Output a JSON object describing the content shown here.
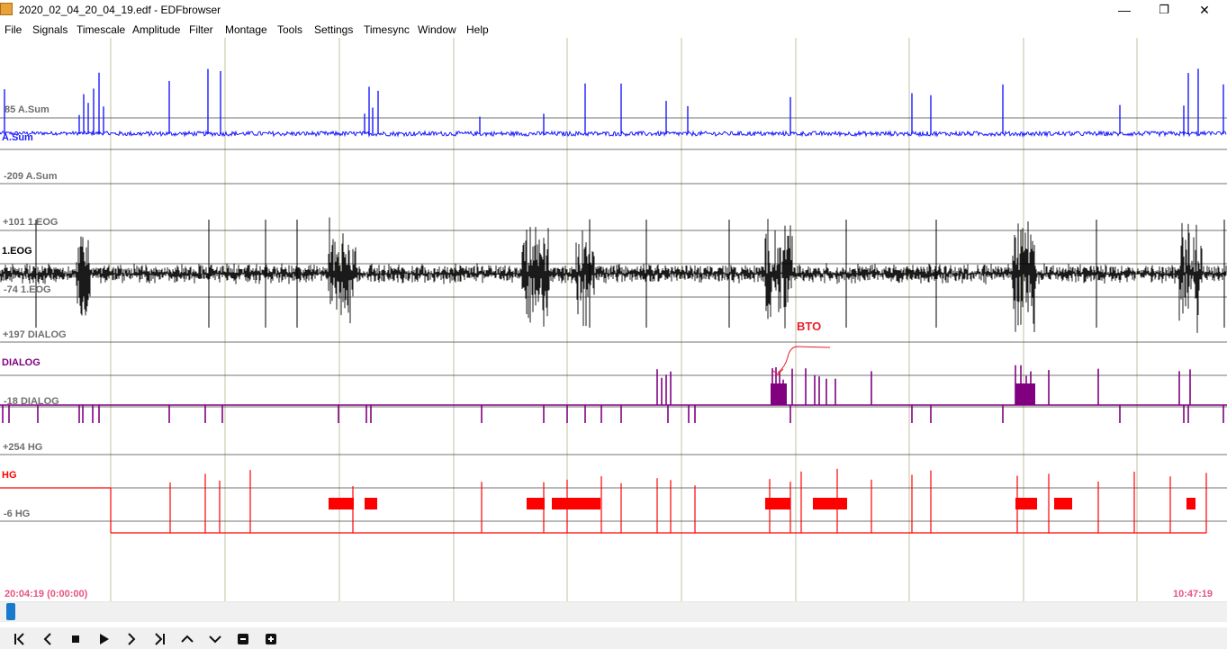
{
  "window": {
    "title": "2020_02_04_20_04_19.edf - EDFbrowser",
    "controls": {
      "minimize": "—",
      "restore": "❐",
      "close": "✕"
    }
  },
  "menu": [
    "File",
    "Signals",
    "Timescale",
    "Amplitude",
    "Filter",
    "Montage",
    "Tools",
    "Settings",
    "Timesync",
    "Window",
    "Help"
  ],
  "signals": [
    {
      "name": "A.Sum",
      "top_scale": "85 A.Sum",
      "bottom_scale": "-209 A.Sum",
      "color": "#1a1aff"
    },
    {
      "name": "1.EOG",
      "top_scale": "+101 1.EOG",
      "bottom_scale": "-74 1.EOG",
      "color": "#000000"
    },
    {
      "name": "DIALOG",
      "top_scale": "+197 DIALOG",
      "bottom_scale": "-18 DIALOG",
      "color": "#800080"
    },
    {
      "name": "HG",
      "top_scale": "+254 HG",
      "bottom_scale": "-6 HG",
      "color": "#ff0000"
    }
  ],
  "annotation": {
    "label": "BTO",
    "color": "#e8202a"
  },
  "timeline": {
    "start": "20:04:19 (0:00:00)",
    "end": "10:47:19"
  },
  "colors": {
    "grid_vertical": "#9a9a6a",
    "grid_horizontal": "#444444",
    "time_label": "#e8537f",
    "scroll_thumb": "#1979ca"
  },
  "toolbar": [
    "first-icon",
    "prev-icon",
    "stop-icon",
    "play-icon",
    "next-icon",
    "last-icon",
    "up-icon",
    "down-icon",
    "zoom-out-icon",
    "zoom-in-icon"
  ]
}
